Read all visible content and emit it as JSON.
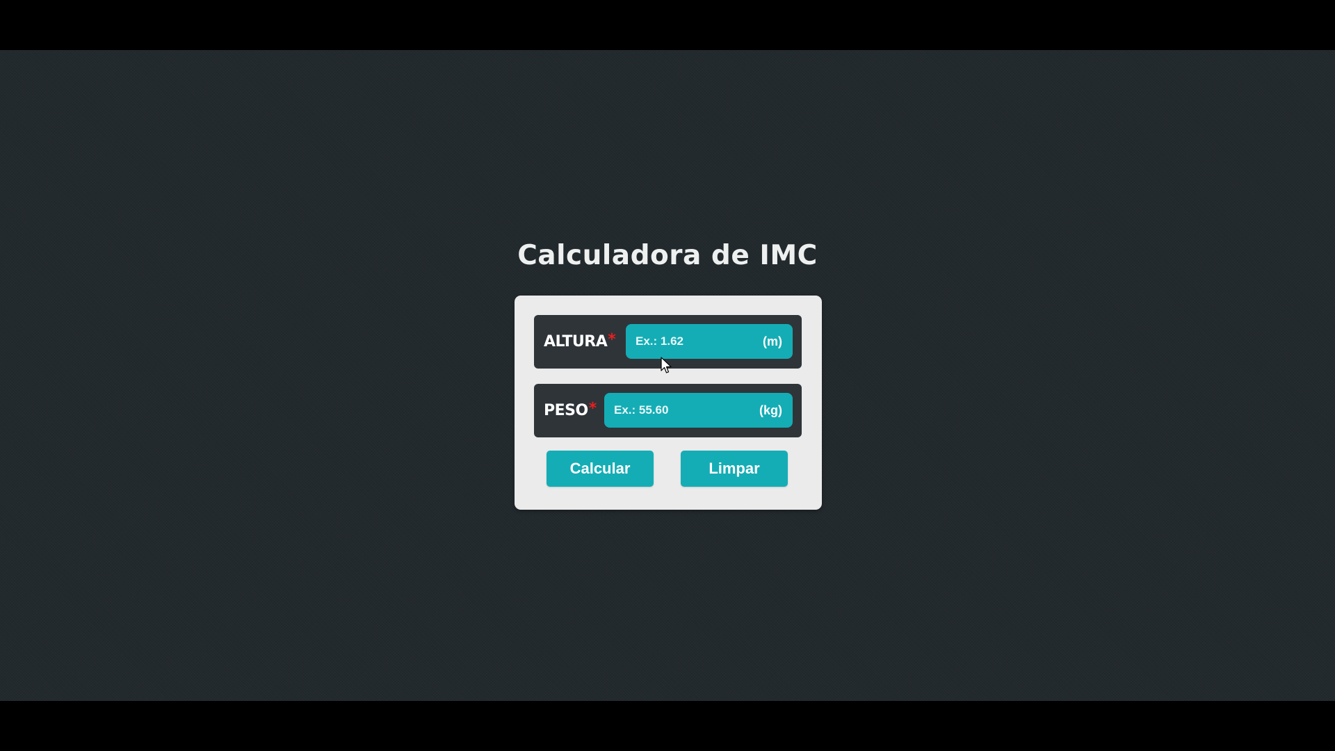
{
  "page": {
    "title": "Calculadora de IMC"
  },
  "form": {
    "altura": {
      "label": "ALTURA",
      "required_mark": "*",
      "value": "",
      "placeholder": "Ex.: 1.62",
      "unit": "(m)"
    },
    "peso": {
      "label": "PESO",
      "required_mark": "*",
      "value": "",
      "placeholder": "Ex.: 55.60",
      "unit": "(kg)"
    },
    "buttons": {
      "calcular": "Calcular",
      "limpar": "Limpar"
    }
  },
  "colors": {
    "background": "#22292d",
    "card": "#ebebeb",
    "field_row": "#2f3439",
    "accent": "#14adb5",
    "required": "#e81f1f",
    "title": "#eef0f0"
  },
  "icons": {
    "cursor": "mouse-pointer-icon"
  }
}
